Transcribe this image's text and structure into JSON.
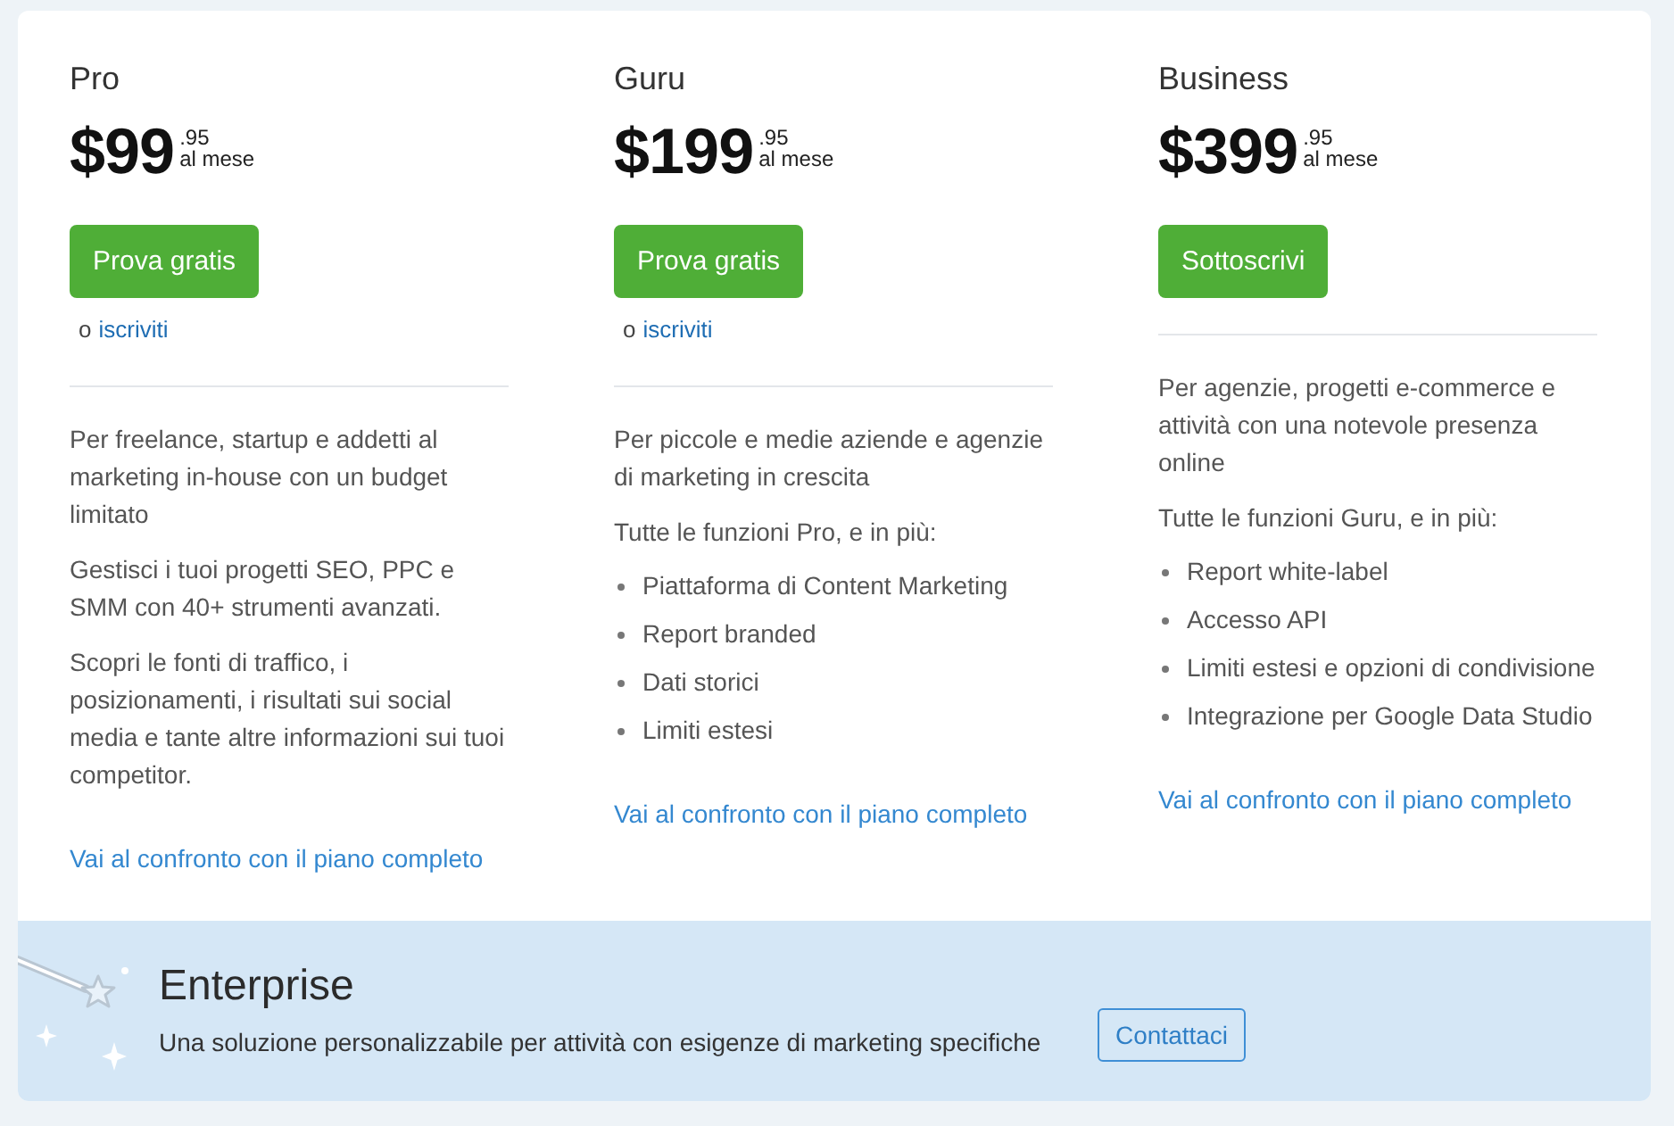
{
  "plans": [
    {
      "name": "Pro",
      "price": "$99",
      "cents": ".95",
      "period": "al mese",
      "button": "Prova gratis",
      "alt_prefix": "o",
      "alt_link": "iscriviti",
      "paragraphs": [
        "Per freelance, startup e addetti al marketing in-house con un budget limitato",
        "Gestisci i tuoi progetti SEO, PPC e SMM con 40+ strumenti avanzati.",
        "Scopri le fonti di traffico, i posizionamenti, i risultati sui social media e tante altre informazioni sui tuoi competitor."
      ],
      "compare_link": "Vai al confronto con il piano completo"
    },
    {
      "name": "Guru",
      "price": "$199",
      "cents": ".95",
      "period": "al mese",
      "button": "Prova gratis",
      "alt_prefix": "o",
      "alt_link": "iscriviti",
      "paragraphs": [
        "Per piccole e medie aziende e agenzie di marketing in crescita",
        "Tutte le funzioni Pro, e in più:"
      ],
      "features": [
        "Piattaforma di Content Marketing",
        "Report branded",
        "Dati storici",
        "Limiti estesi"
      ],
      "compare_link": "Vai al confronto con il piano completo"
    },
    {
      "name": "Business",
      "price": "$399",
      "cents": ".95",
      "period": "al mese",
      "button": "Sottoscrivi",
      "paragraphs": [
        "Per agenzie, progetti e-commerce e attività con una notevole presenza online",
        "Tutte le funzioni Guru, e in più:"
      ],
      "features": [
        "Report white-label",
        "Accesso API",
        "Limiti estesi e opzioni di condivisione",
        "Integrazione per Google Data Studio"
      ],
      "compare_link": "Vai al confronto con il piano completo"
    }
  ],
  "enterprise": {
    "title": "Enterprise",
    "description": "Una soluzione personalizzabile per attività con esigenze di marketing specifiche",
    "button": "Contattaci"
  }
}
